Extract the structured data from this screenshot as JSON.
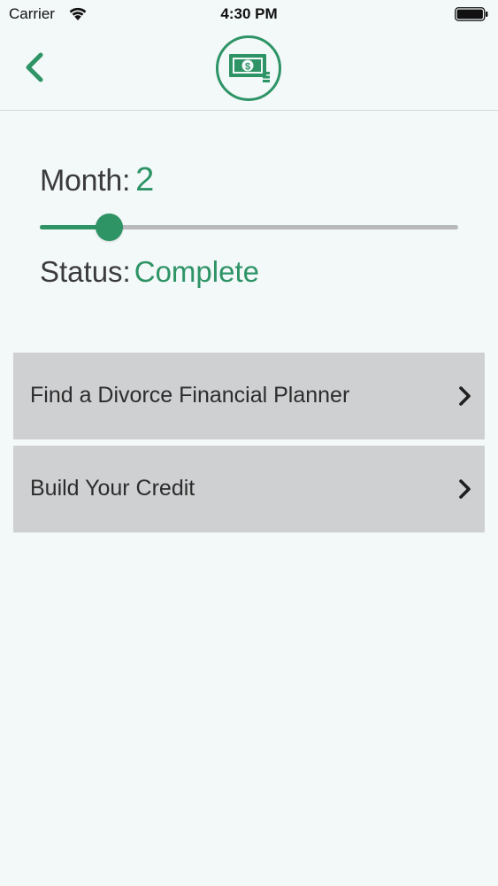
{
  "status_bar": {
    "carrier": "Carrier",
    "time": "4:30 PM"
  },
  "nav": {
    "back_icon": "chevron-left-icon",
    "logo_icon": "cash-icon"
  },
  "month": {
    "label": "Month:",
    "value": "2"
  },
  "slider": {
    "fraction": 0.165
  },
  "status": {
    "label": "Status:",
    "value": "Complete"
  },
  "list": {
    "items": [
      {
        "label": "Find a Divorce Financial Planner",
        "icon": "chevron-right-icon"
      },
      {
        "label": "Build Your Credit",
        "icon": "chevron-right-icon"
      }
    ]
  },
  "colors": {
    "accent": "#2e9466",
    "background": "#f3f8f9",
    "list_item_bg": "#cfd0d2",
    "track": "#b7b9ba"
  }
}
